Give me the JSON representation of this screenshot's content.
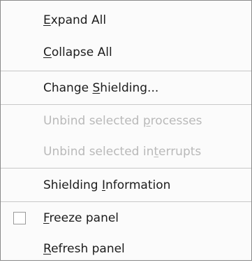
{
  "menu": {
    "expand_all": {
      "pre": "",
      "mnemonic": "E",
      "post": "xpand All"
    },
    "collapse_all": {
      "pre": "",
      "mnemonic": "C",
      "post": "ollapse All"
    },
    "change_shielding": {
      "pre": "Change ",
      "mnemonic": "S",
      "post": "hielding..."
    },
    "unbind_processes": {
      "pre": "Unbind selected ",
      "mnemonic": "p",
      "post": "rocesses"
    },
    "unbind_interrupts": {
      "pre": "Unbind selected in",
      "mnemonic": "t",
      "post": "errupts"
    },
    "shielding_information": {
      "pre": "Shielding ",
      "mnemonic": "I",
      "post": "nformation"
    },
    "freeze_panel": {
      "pre": "",
      "mnemonic": "F",
      "post": "reeze panel",
      "checked": false
    },
    "refresh_panel": {
      "pre": "",
      "mnemonic": "R",
      "post": "efresh panel"
    }
  }
}
